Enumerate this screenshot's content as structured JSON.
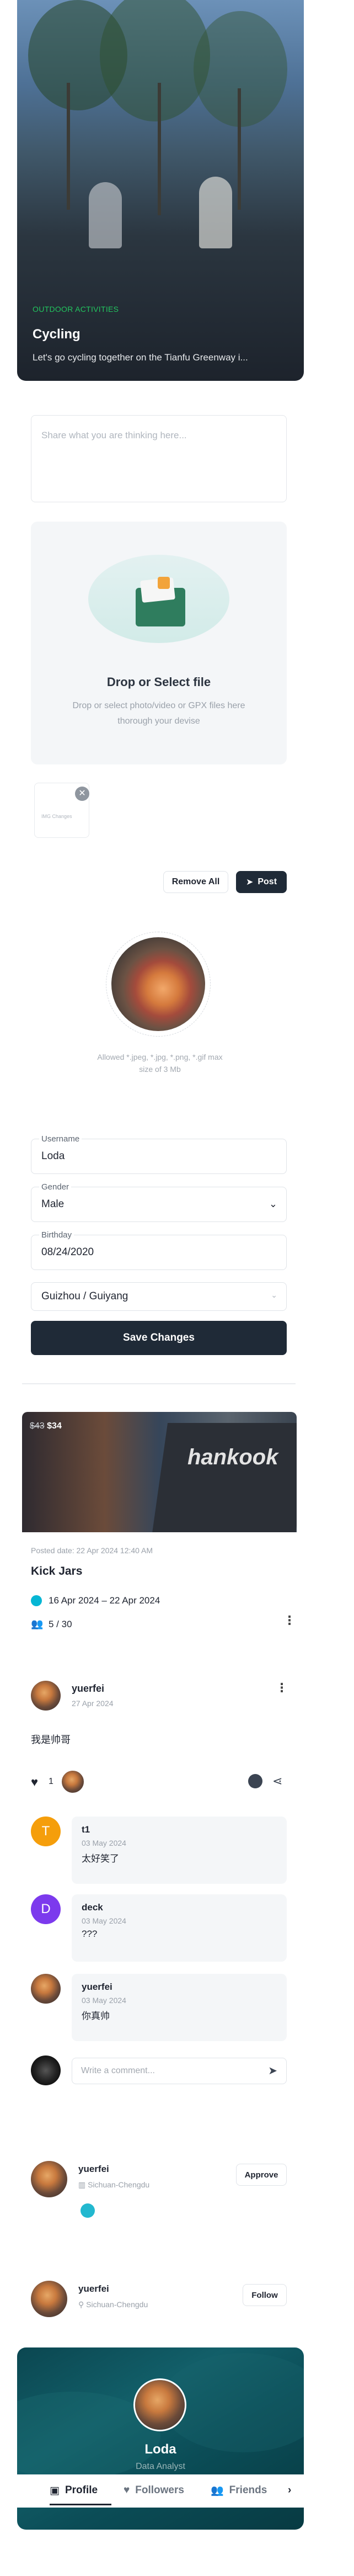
{
  "activity": {
    "category": "OUTDOOR ACTIVITIES",
    "title": "Cycling",
    "description": "Let's go cycling together on the Tianfu Greenway i..."
  },
  "composer": {
    "placeholder": "Share what you are thinking here..."
  },
  "upload": {
    "title": "Drop or Select file",
    "hint": "Drop or select photo/video or GPX files here thorough your devise",
    "file_name": "IMG Changes"
  },
  "actions": {
    "remove_all": "Remove All",
    "post": "Post"
  },
  "avatar_upload": {
    "hint": "Allowed *.jpeg, *.jpg, *.png, *.gif max size of 3 Mb"
  },
  "form": {
    "username_label": "Username",
    "username": "Loda",
    "gender_label": "Gender",
    "gender": "Male",
    "birthday_label": "Birthday",
    "birthday": "08/24/2020",
    "location": "Guizhou / Guiyang",
    "save": "Save Changes"
  },
  "event": {
    "old_price": "$43",
    "price": "$34",
    "posted": "Posted date: 22 Apr 2024 12:40 AM",
    "title": "Kick Jars",
    "date_range": "16 Apr 2024 – 22 Apr 2024",
    "capacity": "5 / 30"
  },
  "post": {
    "author": "yuerfei",
    "date": "27 Apr 2024",
    "text": "我是帅哥",
    "likes": "1",
    "comments": [
      {
        "initial": "T",
        "name": "t1",
        "date": "03 May 2024",
        "text": "太好笑了"
      },
      {
        "initial": "D",
        "name": "deck",
        "date": "03 May 2024",
        "text": "???"
      },
      {
        "initial": "",
        "name": "yuerfei",
        "date": "03 May 2024",
        "text": "你真帅"
      }
    ],
    "comment_placeholder": "Write a comment..."
  },
  "request": {
    "name": "yuerfei",
    "location": "Sichuan-Chengdu",
    "approve": "Approve"
  },
  "follow": {
    "name": "yuerfei",
    "location": "Sichuan-Chengdu",
    "follow": "Follow"
  },
  "profile": {
    "name": "Loda",
    "role": "Data Analyst",
    "tabs": [
      "Profile",
      "Followers",
      "Friends"
    ]
  },
  "colors": {
    "accent": "#22c55e",
    "dark": "#1f2a37",
    "teal": "#0e5560",
    "cyan": "#06b6d4"
  }
}
